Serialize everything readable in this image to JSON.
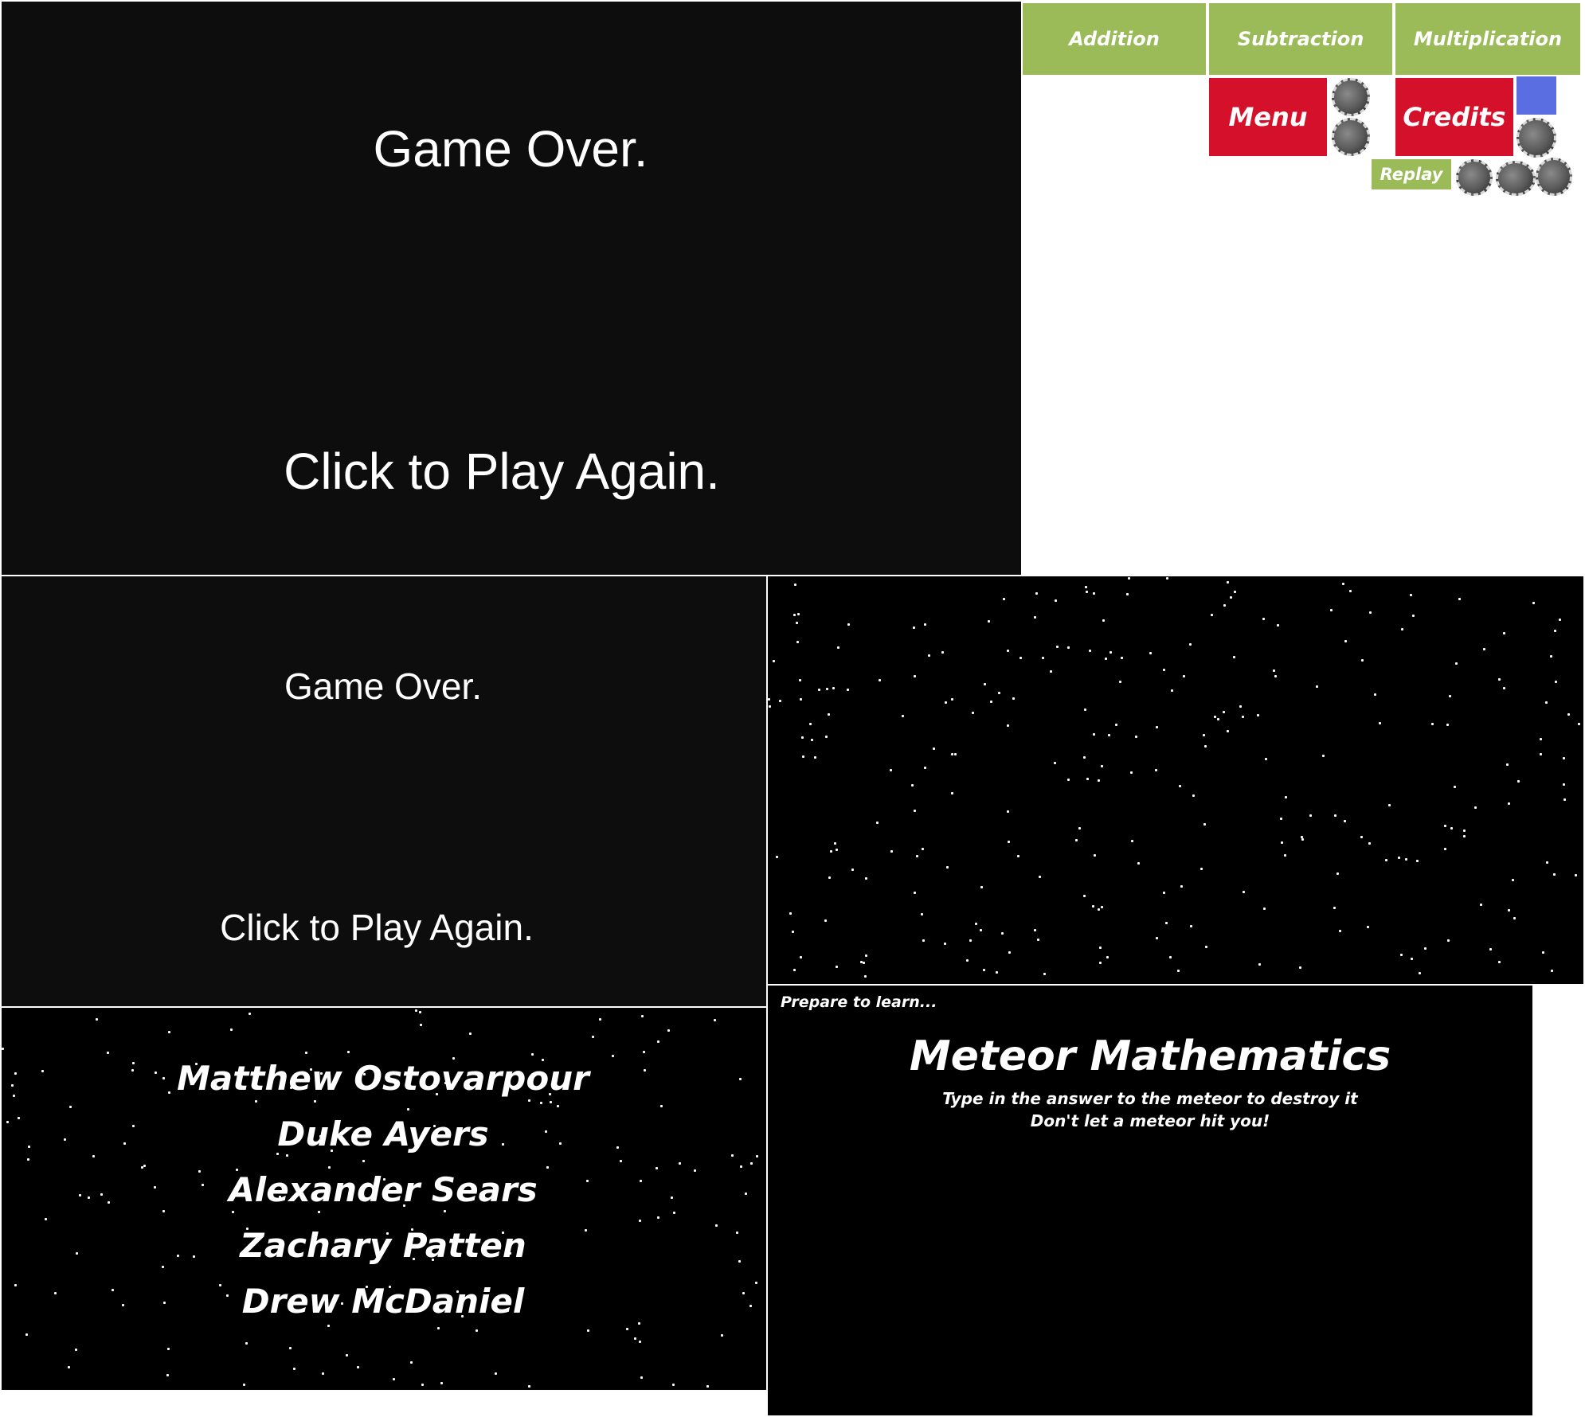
{
  "game_over_large": {
    "title": "Game Over.",
    "play_again": "Click to Play Again."
  },
  "game_over_small": {
    "title": "Game Over.",
    "play_again": "Click to Play Again."
  },
  "buttons": {
    "addition": "Addition",
    "subtraction": "Subtraction",
    "multiplication": "Multiplication",
    "menu": "Menu",
    "credits": "Credits",
    "replay": "Replay"
  },
  "credits": {
    "names": [
      "Matthew Ostovarpour",
      "Duke Ayers",
      "Alexander Sears",
      "Zachary Patten",
      "Drew McDaniel"
    ]
  },
  "intro": {
    "prepare": "Prepare to learn...",
    "title": "Meteor Mathematics",
    "instruction_1": "Type in the answer to the meteor to destroy it",
    "instruction_2": "Don't let a meteor hit you!"
  },
  "colors": {
    "button_green": "#9bbb59",
    "button_red": "#d5102b",
    "accent_blue": "#5b6ee1",
    "background": "#000000"
  }
}
